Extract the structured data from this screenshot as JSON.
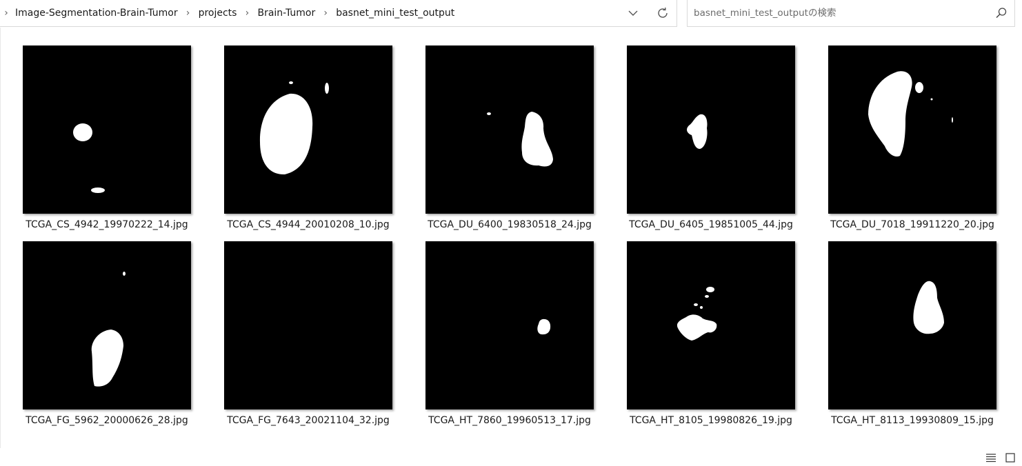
{
  "breadcrumbs": [
    "Image-Segmentation-Brain-Tumor",
    "projects",
    "Brain-Tumor",
    "basnet_mini_test_output"
  ],
  "search": {
    "placeholder": "basnet_mini_test_outputの検索"
  },
  "icons": {
    "breadcrumb_separator": "chevron-right-icon",
    "history": "chevron-down-icon",
    "refresh": "refresh-icon",
    "search": "search-icon",
    "details_view": "details-view-icon",
    "large_icons_view": "large-icons-view-icon"
  },
  "colors": {
    "thumbnail_background": "#000000",
    "mask": "#ffffff"
  },
  "files": [
    {
      "name": "TCGA_CS_4942_19970222_14.jpg"
    },
    {
      "name": "TCGA_CS_4944_20010208_10.jpg"
    },
    {
      "name": "TCGA_DU_6400_19830518_24.jpg"
    },
    {
      "name": "TCGA_DU_6405_19851005_44.jpg"
    },
    {
      "name": "TCGA_DU_7018_19911220_20.jpg"
    },
    {
      "name": "TCGA_FG_5962_20000626_28.jpg"
    },
    {
      "name": "TCGA_FG_7643_20021104_32.jpg"
    },
    {
      "name": "TCGA_HT_7860_19960513_17.jpg"
    },
    {
      "name": "TCGA_HT_8105_19980826_19.jpg"
    },
    {
      "name": "TCGA_HT_8113_19930809_15.jpg"
    }
  ]
}
